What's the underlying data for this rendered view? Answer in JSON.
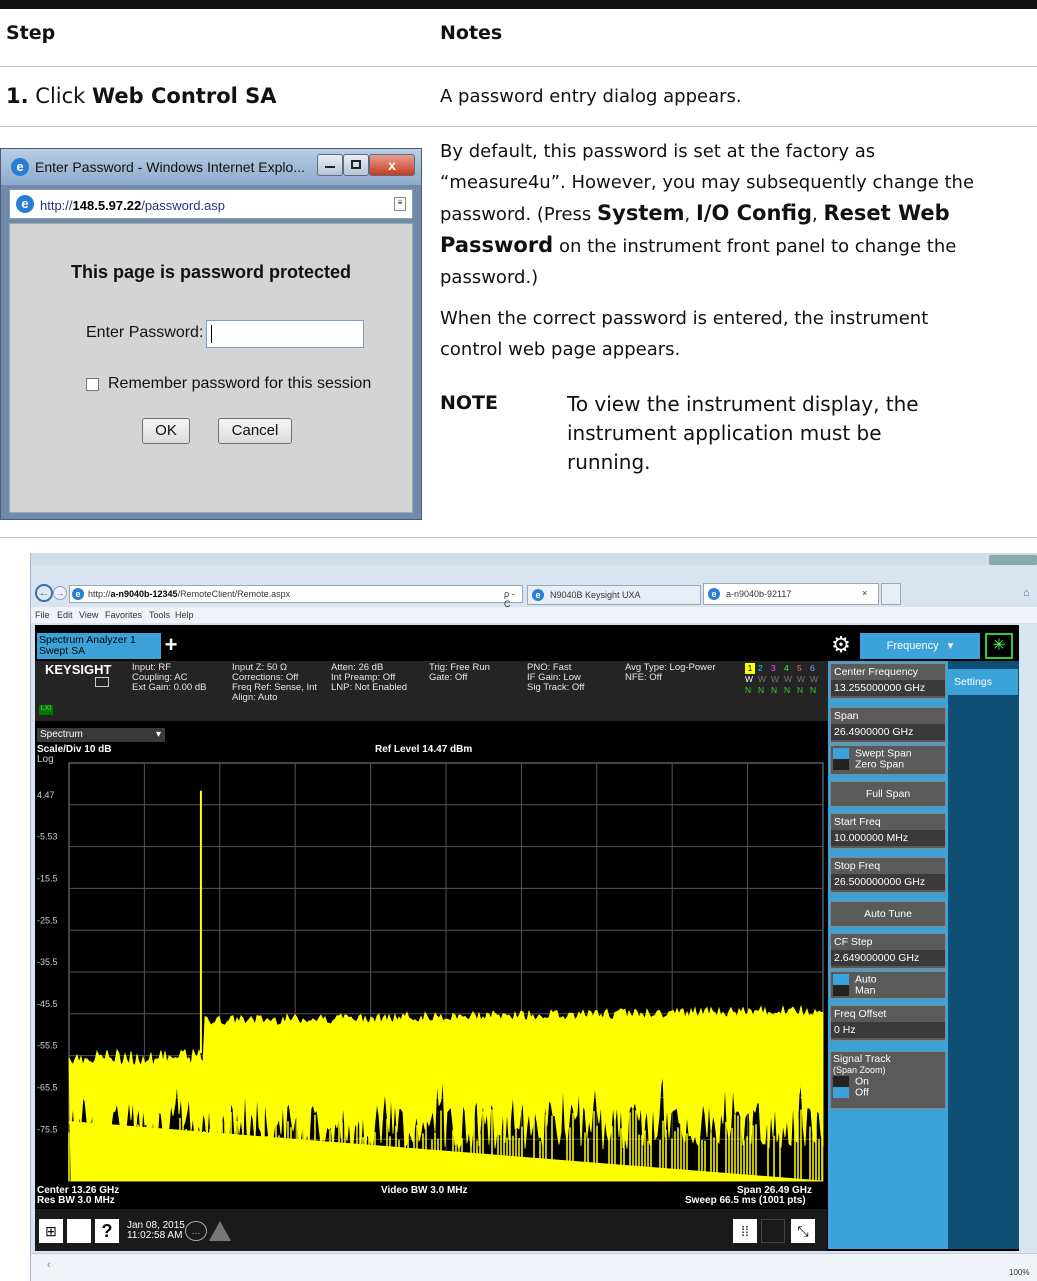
{
  "table": {
    "col_step": "Step",
    "col_notes": "Notes",
    "row1": {
      "num": "1.",
      "pre": "Click",
      "bold": "Web Control SA",
      "note": "A password entry dialog appears."
    },
    "row2": {
      "p1_a": "By default, this password is set at the factory as",
      "p1_b": "“measure4u”. However, you may subsequently change the",
      "p1_c": "password. (Press",
      "k_system": "System",
      "sep1": ",",
      "k_io": "I/O Config",
      "sep2": ",",
      "k_reset": "Reset Web",
      "k_pw": "Password",
      "p1_d": "on the instrument front panel to change the",
      "p1_e": "password.)",
      "p2_a": "When the correct password is entered, the instrument",
      "p2_b": "control web page appears.",
      "note_label": "NOTE",
      "note_a": "To view the instrument display, the",
      "note_b": "instrument application must be",
      "note_c": "running."
    }
  },
  "dialog": {
    "title": "Enter Password - Windows Internet Explo...",
    "url_prefix": "http://",
    "url_host": "148.5.97.22",
    "url_path": "/password.asp",
    "heading": "This page is password protected",
    "label": "Enter Password:",
    "input_value": "",
    "remember": "Remember password for this session",
    "ok": "OK",
    "cancel": "Cancel"
  },
  "browser": {
    "url_prefix": "http://",
    "url_host": "a-n9040b-12345",
    "url_path": "/RemoteClient/Remote.aspx",
    "search": "ρ - C",
    "tab1": "N9040B Keysight UXA",
    "tab2": "a-n9040b-92117",
    "tab_close": "×",
    "menu": [
      "File",
      "Edit",
      "View",
      "Favorites",
      "Tools",
      "Help"
    ],
    "status_zoom": "100%"
  },
  "analyzer": {
    "mode1": "Spectrum Analyzer 1",
    "mode2": "Swept SA",
    "brand": "KEYSIGHT",
    "lxi": "LXI",
    "status_cols": [
      [
        "Input: RF",
        "Coupling: AC",
        "Ext Gain: 0.00 dB"
      ],
      [
        "Input Z: 50 Ω",
        "Corrections: Off",
        "Freq Ref: Sense, Int",
        "Align: Auto"
      ],
      [
        "Atten: 26 dB",
        "Int Preamp: Off",
        "LNP: Not Enabled"
      ],
      [
        "Trig: Free Run",
        "Gate: Off"
      ],
      [
        "PNO: Fast",
        "IF Gain: Low",
        "Sig Track: Off"
      ],
      [
        "Avg Type: Log-Power",
        "NFE: Off"
      ]
    ],
    "trace_nums": [
      "1",
      "2",
      "3",
      "4",
      "5",
      "6"
    ],
    "trace_w": [
      "W",
      "W",
      "W",
      "W",
      "W",
      "W"
    ],
    "trace_n": [
      "N",
      "N",
      "N",
      "N",
      "N",
      "N"
    ],
    "menu_title": "Frequency",
    "window_label": "Spectrum",
    "scale": "Scale/Div 10 dB",
    "log": "Log",
    "ref_level": "Ref Level 14.47 dBm",
    "y_ticks": [
      "4.47",
      "-5.53",
      "-15.5",
      "-25.5",
      "-35.5",
      "-45.5",
      "-55.5",
      "-65.5",
      "-75.5"
    ],
    "center": "Center 13.26 GHz",
    "res_bw": "Res BW 3.0 MHz",
    "video_bw": "Video BW 3.0 MHz",
    "span_lbl": "Span 26.49 GHz",
    "sweep": "Sweep 66.5 ms (1001 pts)",
    "date": "Jan 08, 2015",
    "time": "11:02:58 AM",
    "settings_tab": "Settings",
    "colors": {
      "trace": "#ffff00",
      "panel": "#3ba3d9",
      "bg": "#000000"
    }
  },
  "panel": {
    "center_freq_label": "Center Frequency",
    "center_freq_value": "13.255000000 GHz",
    "span_label": "Span",
    "span_value": "26.4900000 GHz",
    "swept_span": "Swept Span",
    "zero_span": "Zero Span",
    "full_span": "Full Span",
    "start_label": "Start Freq",
    "start_value": "10.000000 MHz",
    "stop_label": "Stop Freq",
    "stop_value": "26.500000000 GHz",
    "auto_tune": "Auto Tune",
    "cf_step_label": "CF Step",
    "cf_step_value": "2.649000000 GHz",
    "auto": "Auto",
    "man": "Man",
    "freq_offset_label": "Freq Offset",
    "freq_offset_value": "0 Hz",
    "signal_track_label": "Signal Track",
    "signal_track_sub": "(Span Zoom)",
    "on": "On",
    "off": "Off"
  }
}
